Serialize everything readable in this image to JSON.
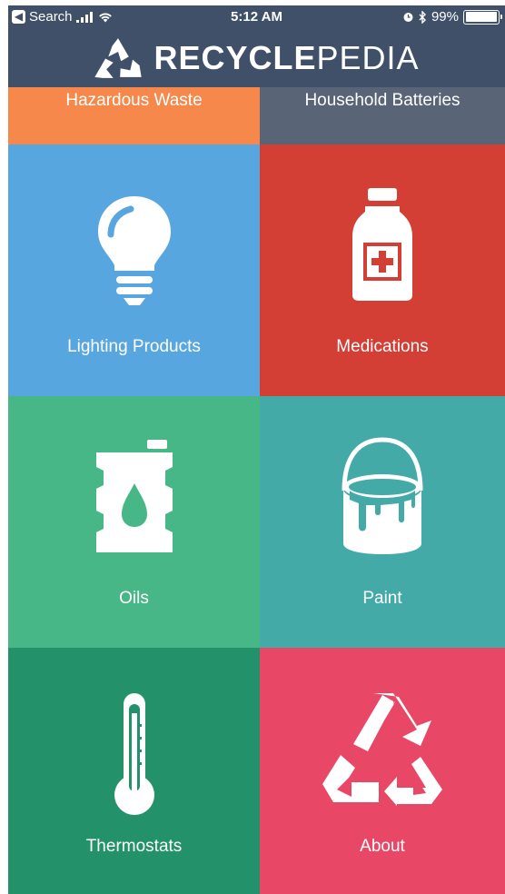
{
  "status_bar": {
    "back_label": "Search",
    "time": "5:12 AM",
    "battery": "99%",
    "battery_level": 0.99
  },
  "header": {
    "brand_bold": "RECYCLE",
    "brand_light": "PEDIA"
  },
  "tiles": [
    {
      "label": "Hazardous Waste",
      "color": "#f5884a"
    },
    {
      "label": "Household Batteries",
      "color": "#596476"
    },
    {
      "label": "Lighting Products",
      "color": "#58a6e0"
    },
    {
      "label": "Medications",
      "color": "#d33f35"
    },
    {
      "label": "Oils",
      "color": "#47b787"
    },
    {
      "label": "Paint",
      "color": "#43aaa8"
    },
    {
      "label": "Thermostats",
      "color": "#23916a"
    },
    {
      "label": "About",
      "color": "#e94766"
    }
  ],
  "icons": [
    "lightbulb-icon",
    "medicine-bottle-icon",
    "oil-drum-icon",
    "paint-can-icon",
    "thermometer-icon",
    "recycle-icon"
  ]
}
